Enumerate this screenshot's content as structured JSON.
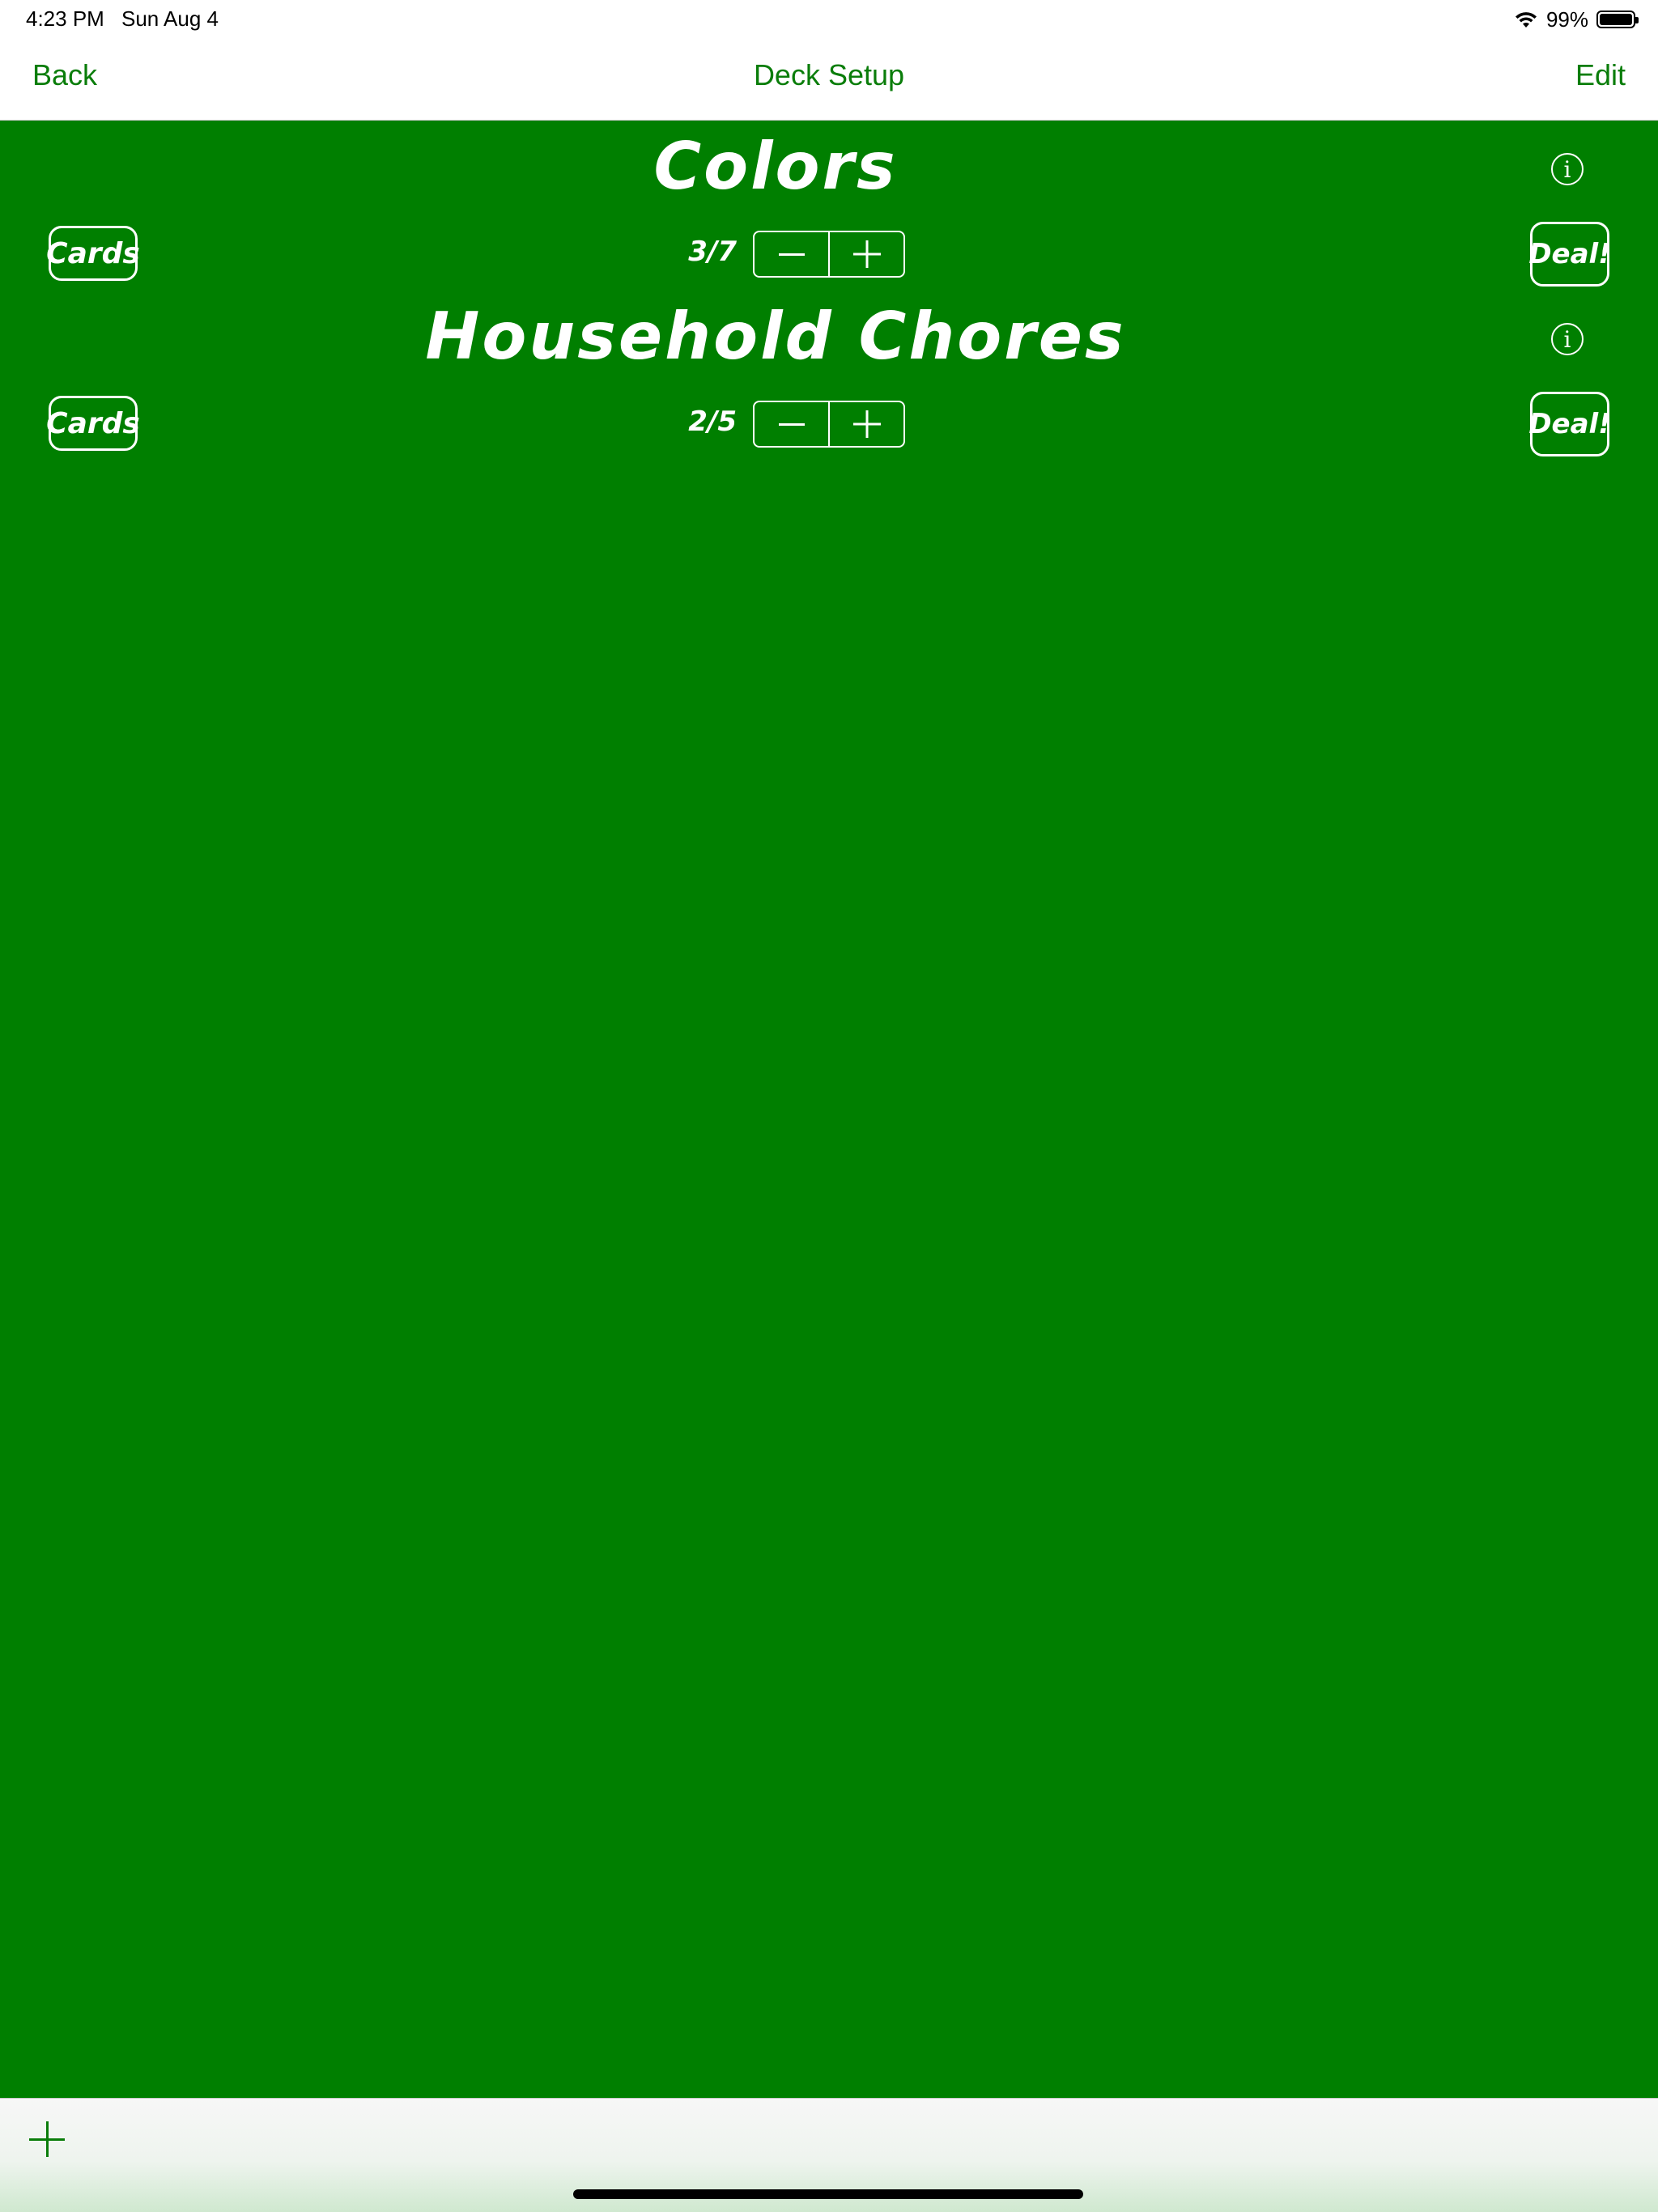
{
  "status_bar": {
    "time": "4:23 PM",
    "date": "Sun Aug 4",
    "battery_percent": "99%",
    "battery_level": 0.99,
    "icons": [
      "wifi-icon",
      "battery-icon"
    ]
  },
  "nav": {
    "back_label": "Back",
    "title": "Deck Setup",
    "edit_label": "Edit"
  },
  "decks": [
    {
      "title": "Colors",
      "cards_label": "Cards",
      "count": "3/7",
      "deal_label": "Deal!",
      "info_glyph": "i"
    },
    {
      "title": "Household Chores",
      "cards_label": "Cards",
      "count": "2/5",
      "deal_label": "Deal!",
      "info_glyph": "i"
    }
  ],
  "toolbar": {
    "add_icon": "plus-icon"
  },
  "colors": {
    "accent": "#0a7d0a",
    "background": "#007f00",
    "foreground": "#ffffff"
  }
}
